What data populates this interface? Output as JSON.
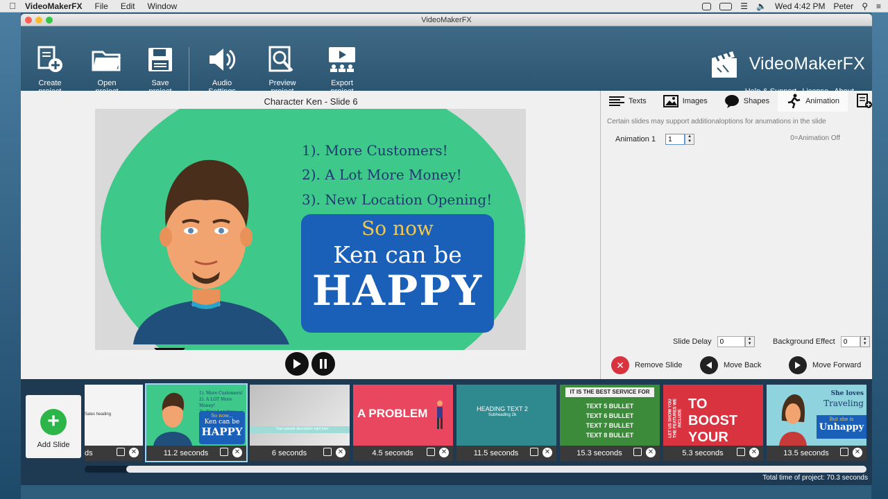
{
  "menubar": {
    "app_name": "VideoMakerFX",
    "items": [
      "File",
      "Edit",
      "Window"
    ],
    "clock": "Wed 4:42 PM",
    "user": "Peter"
  },
  "window": {
    "title": "VideoMakerFX"
  },
  "toolbar": {
    "buttons": [
      {
        "label": "Create project",
        "icon": "new-file-icon"
      },
      {
        "label": "Open project",
        "icon": "folder-icon"
      },
      {
        "label": "Save project",
        "icon": "floppy-disk-icon"
      },
      {
        "label": "Audio Settings",
        "icon": "speaker-icon"
      },
      {
        "label": "Preview project",
        "icon": "magnifier-icon"
      },
      {
        "label": "Export project",
        "icon": "export-icon"
      }
    ],
    "brand": "VideoMakerFX",
    "links": [
      "Help & Support",
      "License",
      "About"
    ]
  },
  "editor": {
    "title": "Character Ken - Slide 6",
    "slide": {
      "lines": [
        "1). More Customers!",
        "2). A Lot More Money!",
        "3). New Location Opening!"
      ],
      "so_now": "So now",
      "ken_can_be": "Ken can be",
      "happy": "HAPPY"
    }
  },
  "panel": {
    "tabs": [
      {
        "label": "Texts",
        "icon": "text-lines-icon"
      },
      {
        "label": "Images",
        "icon": "image-icon"
      },
      {
        "label": "Shapes",
        "icon": "speech-bubble-icon"
      },
      {
        "label": "Animation",
        "icon": "running-figure-icon"
      }
    ],
    "hint": "Certain slides may support additionaloptions for anumations in the slide",
    "animation_label": "Animation 1",
    "animation_value": "1",
    "animation_note": "0=Animation Off",
    "slide_delay_label": "Slide Delay",
    "slide_delay_value": "0",
    "bg_effect_label": "Background Effect",
    "bg_effect_value": "0",
    "remove_slide": "Remove Slide",
    "move_back": "Move Back",
    "move_forward": "Move Forward"
  },
  "strip": {
    "add_slide": "Add Slide",
    "slides": [
      {
        "seconds": "ds",
        "caption": "Sales heading"
      },
      {
        "seconds": "11.2 seconds",
        "caption": "So now... Ken can be HAPPY"
      },
      {
        "seconds": "6 seconds",
        "caption": "Your sample description right here"
      },
      {
        "seconds": "4.5 seconds",
        "caption": "A PROBLEM"
      },
      {
        "seconds": "11.5 seconds",
        "caption": "HEADING TEXT 2",
        "sub": "Subheading 2b"
      },
      {
        "seconds": "15.3 seconds",
        "caption": "IT IS THE BEST SERVICE FOR",
        "bullets": [
          "TEXT 5 BULLET",
          "TEXT 6 BULLET",
          "TEXT 7 BULLET",
          "TEXT 8 BULLET"
        ]
      },
      {
        "seconds": "5.3 seconds",
        "caption": "TO BOOST YOUR PROFIT",
        "side": "LET US SHOW YOU THE FEATURES WE INCLUDE"
      },
      {
        "seconds": "13.5 seconds",
        "caption": "She loves",
        "c2": "Traveling",
        "c3": "But she is",
        "c4": "Unhappy"
      }
    ],
    "total": "Total time of project: 70.3 seconds"
  }
}
